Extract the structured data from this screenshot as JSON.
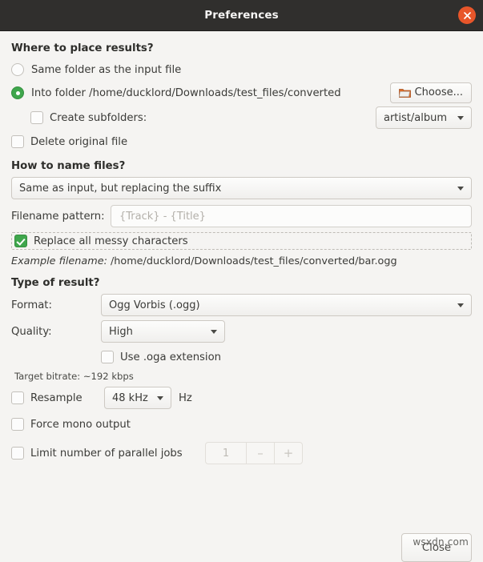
{
  "window": {
    "title": "Preferences",
    "close_icon": "close-circle-icon",
    "accent_close": "#e8562a",
    "titlebar_bg": "#302f2d",
    "body_bg": "#f5f4f2",
    "accent_green": "#3fa64c"
  },
  "where": {
    "heading": "Where to place results?",
    "option_same_folder": "Same folder as the input file",
    "option_into_folder": "Into folder /home/ducklord/Downloads/test_files/converted",
    "selected": "into_folder",
    "choose_button": "Choose...",
    "choose_icon": "folder-icon",
    "create_subfolders_label": "Create subfolders:",
    "create_subfolders_checked": false,
    "subfolders_pattern": "artist/album",
    "delete_original_label": "Delete original file",
    "delete_original_checked": false
  },
  "naming": {
    "heading": "How to name files?",
    "scheme_selected": "Same as input, but replacing the suffix",
    "pattern_label": "Filename pattern:",
    "pattern_placeholder": "{Track} - {Title}",
    "pattern_value": "",
    "replace_messy_label": "Replace all messy characters",
    "replace_messy_checked": true,
    "example_prefix": "Example filename:",
    "example_path": " /home/ducklord/Downloads/test_files/converted/bar.ogg"
  },
  "result": {
    "heading": "Type of result?",
    "format_label": "Format:",
    "format_value": "Ogg Vorbis (.ogg)",
    "quality_label": "Quality:",
    "quality_value": "High",
    "oga_label": "Use .oga extension",
    "oga_checked": false,
    "bitrate_hint": "Target bitrate: ~192 kbps",
    "resample_label": "Resample",
    "resample_checked": false,
    "resample_value": "48 kHz",
    "resample_unit": "Hz",
    "mono_label": "Force mono output",
    "mono_checked": false,
    "jobs_label": "Limit number of parallel jobs",
    "jobs_checked": false,
    "jobs_value": "1",
    "jobs_minus": "–",
    "jobs_plus": "+"
  },
  "footer": {
    "close_label": "Close"
  },
  "watermark": {
    "text": "wsxdn.com"
  }
}
